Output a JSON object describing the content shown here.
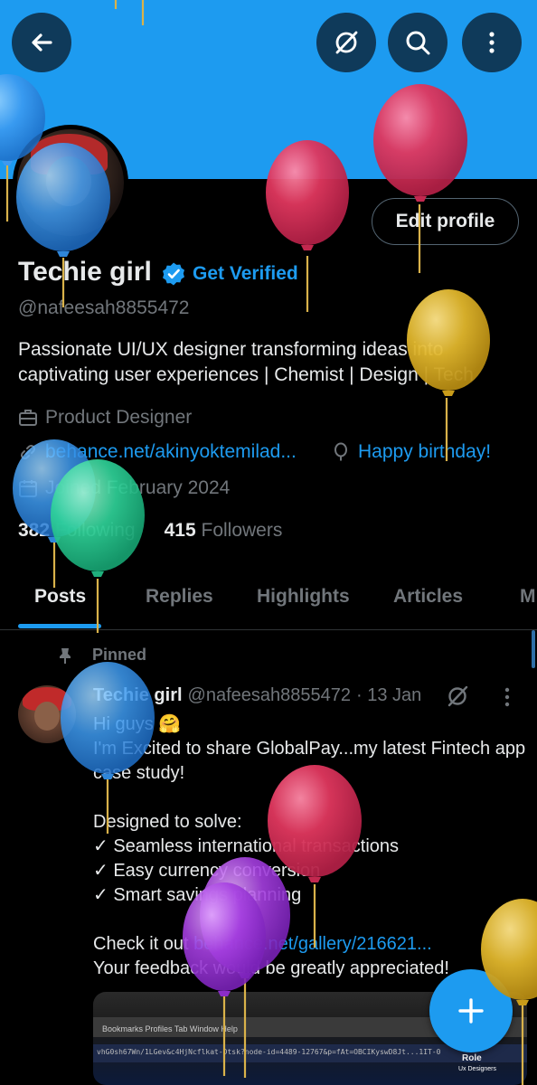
{
  "header": {
    "back_icon": "arrow-left-icon",
    "grok_icon": "grok-icon",
    "search_icon": "search-icon",
    "more_icon": "more-vertical-icon",
    "banner_color": "#1d9bf0"
  },
  "profile": {
    "edit_label": "Edit profile",
    "display_name": "Techie girl",
    "verified_icon": "verified-badge-icon",
    "get_verified": "Get Verified",
    "handle": "@nafeesah8855472",
    "bio": "Passionate UI/UX designer transforming ideas into captivating user experiences | Chemist | Design | Tech",
    "job": "Product Designer",
    "website": "behance.net/akinyoktemilad...",
    "birthday": "Happy birthday!",
    "joined": "Joined February 2024",
    "following_count": "382",
    "following_label": "Following",
    "followers_count": "415",
    "followers_label": "Followers"
  },
  "tabs": [
    "Posts",
    "Replies",
    "Highlights",
    "Articles",
    "M"
  ],
  "active_tab": "Posts",
  "post": {
    "pinned_label": "Pinned",
    "author_name": "Techie girl",
    "author_handle": "@nafeesah8855472",
    "date": "· 13 Jan",
    "line1": "Hi guys 🤗",
    "line2": "I'm Excited to share GlobalPay...my latest Fintech app case study!",
    "line3": "Designed to solve:",
    "bullet1": "✓ Seamless international transactions",
    "bullet2": "✓ Easy currency conversion",
    "bullet3": "✓ Smart savings planning",
    "line4_prefix": "Check it out ",
    "line4_link": "behance.net/gallery/216621...",
    "line5": "Your feedback would be greatly appreciated!",
    "media": {
      "tabs_text": "Bookmarks   Profiles   Tab   Window   Help",
      "url_text": "vhG0sh67Wn/1LGev&c4HjNcflkat-Dtsk?node-id=4489-12767&p=fAt=OBCIKyswD8Jt...1IT-0",
      "brand": "Role",
      "brand_sub": "Ux Designers"
    }
  },
  "fab": {
    "icon": "plus-icon"
  },
  "colors": {
    "accent": "#1d9bf0",
    "muted": "#71767b",
    "text": "#e7e9ea",
    "bg": "#000000"
  },
  "decorations": {
    "balloons": "birthday-balloons"
  }
}
